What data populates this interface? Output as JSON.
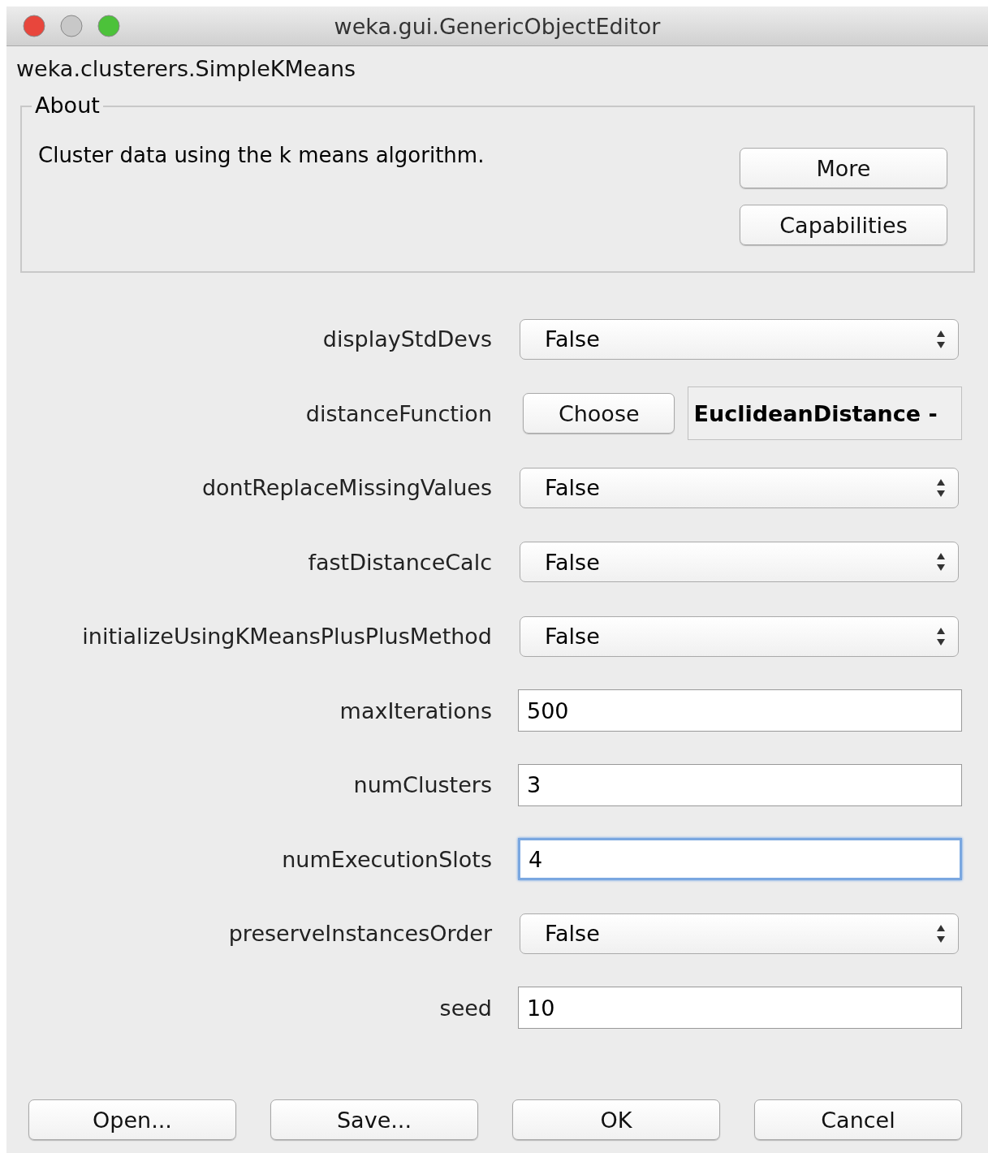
{
  "window": {
    "title": "weka.gui.GenericObjectEditor"
  },
  "class_name": "weka.clusterers.SimpleKMeans",
  "about": {
    "title": "About",
    "text": "Cluster data using the k means algorithm.",
    "buttons": [
      "More",
      "Capabilities"
    ]
  },
  "properties": [
    {
      "label": "displayStdDevs",
      "kind": "select",
      "value": "False"
    },
    {
      "label": "distanceFunction",
      "kind": "choose",
      "button": "Choose",
      "value": "EuclideanDistance -"
    },
    {
      "label": "dontReplaceMissingValues",
      "kind": "select",
      "value": "False"
    },
    {
      "label": "fastDistanceCalc",
      "kind": "select",
      "value": "False"
    },
    {
      "label": "initializeUsingKMeansPlusPlusMethod",
      "kind": "select",
      "value": "False"
    },
    {
      "label": "maxIterations",
      "kind": "text",
      "value": "500",
      "focused": false
    },
    {
      "label": "numClusters",
      "kind": "text",
      "value": "3",
      "focused": false
    },
    {
      "label": "numExecutionSlots",
      "kind": "text",
      "value": "4",
      "focused": true
    },
    {
      "label": "preserveInstancesOrder",
      "kind": "select",
      "value": "False"
    },
    {
      "label": "seed",
      "kind": "text",
      "value": "10",
      "focused": false
    }
  ],
  "buttons": [
    "Open...",
    "Save...",
    "OK",
    "Cancel"
  ]
}
